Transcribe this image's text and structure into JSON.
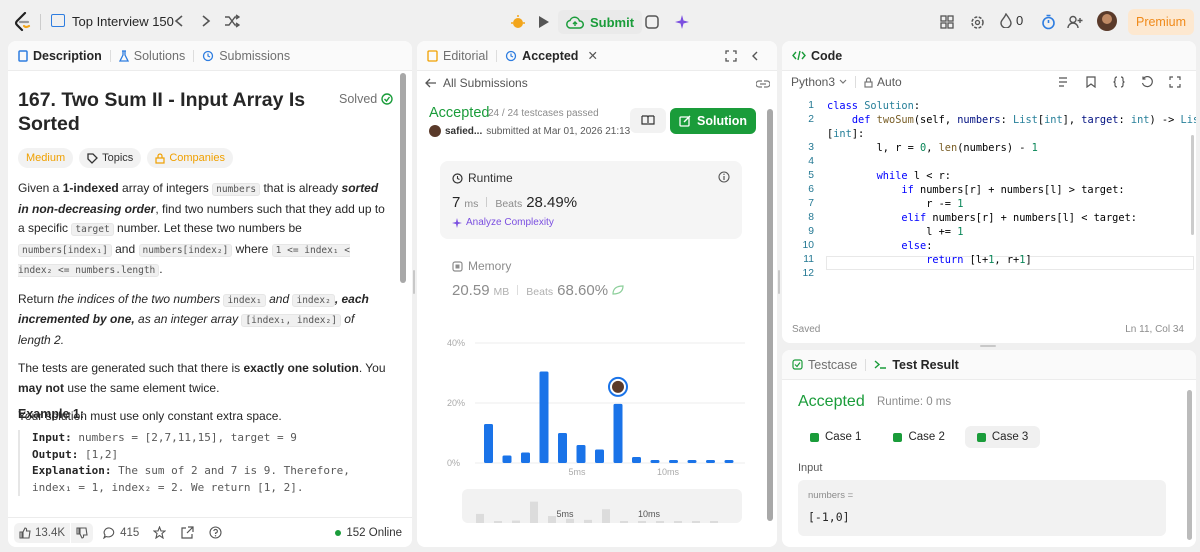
{
  "topbar": {
    "list_title": "Top Interview 150",
    "submit_label": "Submit",
    "streak_count": "0",
    "premium_label": "Premium"
  },
  "left": {
    "tabs": [
      "Description",
      "Solutions",
      "Submissions"
    ],
    "title": "167. Two Sum II - Input Array Is Sorted",
    "solved": "Solved",
    "tags": [
      "Medium",
      "Topics",
      "Companies"
    ],
    "p1": {
      "a": "Given a ",
      "b": "1-indexed",
      "c": " array of integers ",
      "d": "numbers",
      "e": " that is already ",
      "f": "sorted in non-decreasing order",
      "g": ", find two numbers such that they add up to a specific ",
      "h": "target",
      "i": " number. Let these two numbers be ",
      "j": "numbers[index₁]",
      "k": " and ",
      "l": "numbers[index₂]",
      "m": " where ",
      "n": "1 <= index₁ < index₂ <= numbers.length",
      "o": "."
    },
    "p2": {
      "a": "Return ",
      "b": "the indices of the two numbers ",
      "c": "index₁",
      "d": " and ",
      "e": "index₂",
      "f": ", each incremented by one,",
      "g": " as an integer array ",
      "h": "[index₁, index₂]",
      "i": " of length 2."
    },
    "p3": {
      "a": "The tests are generated such that there is ",
      "b": "exactly one solution",
      "c": ". You ",
      "d": "may not",
      "e": " use the same element twice."
    },
    "p4": "Your solution must use only constant extra space.",
    "example_title": "Example 1:",
    "example": {
      "l1k": "Input:",
      "l1v": " numbers = [2,7,11,15], target = 9",
      "l2k": "Output:",
      "l2v": " [1,2]",
      "l3k": "Explanation:",
      "l3v": " The sum of 2 and 7 is 9. Therefore,",
      "l4": "index₁ = 1, index₂ = 2. We return [1, 2]."
    },
    "footer": {
      "likes": "13.4K",
      "comments": "415",
      "online": "152 Online"
    }
  },
  "mid": {
    "tabs": [
      "Editorial",
      "Accepted"
    ],
    "back": "All Submissions",
    "status": "Accepted",
    "testcases": "24 / 24 testcases passed",
    "user": "safied...",
    "submitted": "submitted at Mar 01, 2026 21:13",
    "solution_btn": "Solution",
    "runtime": {
      "label": "Runtime",
      "value": "7",
      "unit": "ms",
      "beats_label": "Beats",
      "beats": "28.49%",
      "analyze": "Analyze Complexity"
    },
    "memory": {
      "label": "Memory",
      "value": "20.59",
      "unit": "MB",
      "beats_label": "Beats",
      "beats": "68.60%"
    },
    "ylabels": [
      "40%",
      "20%",
      "0%"
    ],
    "xlabels": [
      "5ms",
      "10ms"
    ],
    "mini_xlabels": [
      "5ms",
      "10ms"
    ],
    "accent": "#1a73e8"
  },
  "chart_data": {
    "type": "bar",
    "ylim": [
      0,
      40
    ],
    "yticks": [
      "40%",
      "20%",
      "0%"
    ],
    "xticks": [
      "5ms",
      "10ms"
    ],
    "values": [
      13,
      2.5,
      3.5,
      30.5,
      10,
      6,
      4.5,
      19.7,
      2,
      1,
      1,
      1,
      1,
      1
    ],
    "highlight_index": 7
  },
  "code": {
    "header": "Code",
    "language": "Python3",
    "mode": "Auto",
    "lines": [
      [
        [
          "class ",
          "kw"
        ],
        [
          "Solution",
          "ty"
        ],
        [
          ":",
          ""
        ]
      ],
      [
        [
          "    ",
          ""
        ],
        [
          "def ",
          "kw"
        ],
        [
          "twoSum",
          "fn"
        ],
        [
          "(self, ",
          ""
        ],
        [
          "numbers",
          "vr"
        ],
        [
          ": ",
          ""
        ],
        [
          "List",
          "ty"
        ],
        [
          "[",
          ""
        ],
        [
          "int",
          "ty"
        ],
        [
          "], ",
          ""
        ],
        [
          "target",
          "vr"
        ],
        [
          ": ",
          ""
        ],
        [
          "int",
          "ty"
        ],
        [
          ") -> ",
          ""
        ],
        [
          "List",
          "ty"
        ]
      ],
      [
        [
          "[",
          ""
        ],
        [
          "int",
          "ty"
        ],
        [
          "]:",
          ""
        ]
      ],
      [
        [
          "        l, r = ",
          ""
        ],
        [
          "0",
          "nm"
        ],
        [
          ", ",
          ""
        ],
        [
          "len",
          "fn"
        ],
        [
          "(numbers) - ",
          ""
        ],
        [
          "1",
          "nm"
        ]
      ],
      [
        [
          "",
          ""
        ]
      ],
      [
        [
          "        ",
          ""
        ],
        [
          "while ",
          "kw"
        ],
        [
          "l < r:",
          ""
        ]
      ],
      [
        [
          "            ",
          ""
        ],
        [
          "if ",
          "kw"
        ],
        [
          "numbers[r] + numbers[l] > target:",
          ""
        ]
      ],
      [
        [
          "                r -= ",
          ""
        ],
        [
          "1",
          "nm"
        ]
      ],
      [
        [
          "            ",
          ""
        ],
        [
          "elif ",
          "kw"
        ],
        [
          "numbers[r] + numbers[l] < target:",
          ""
        ]
      ],
      [
        [
          "                l += ",
          ""
        ],
        [
          "1",
          "nm"
        ]
      ],
      [
        [
          "            ",
          ""
        ],
        [
          "else",
          "kw"
        ],
        [
          ":",
          ""
        ]
      ],
      [
        [
          "                ",
          ""
        ],
        [
          "return ",
          "kw"
        ],
        [
          "[l+",
          ""
        ],
        [
          "1",
          "nm"
        ],
        [
          ", r+",
          ""
        ],
        [
          "1",
          "nm"
        ],
        [
          "]",
          ""
        ]
      ],
      [
        [
          "",
          ""
        ]
      ]
    ],
    "line_numbers": [
      "1",
      "2",
      "",
      "3",
      "4",
      "5",
      "6",
      "7",
      "8",
      "9",
      "10",
      "11",
      "12"
    ],
    "saved": "Saved",
    "cursor": "Ln 11, Col 34"
  },
  "result": {
    "tabs": [
      "Testcase",
      "Test Result"
    ],
    "status": "Accepted",
    "runtime": "Runtime: 0 ms",
    "cases": [
      "Case 1",
      "Case 2",
      "Case 3"
    ],
    "input_label": "Input",
    "var_name": "numbers =",
    "var_value": "[-1,0]"
  }
}
